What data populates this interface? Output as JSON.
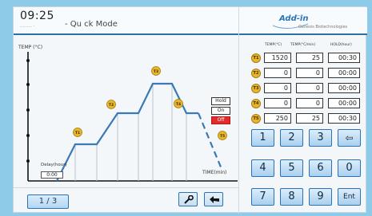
{
  "header": {
    "time": "09:25",
    "time_sub": "……… ·",
    "mode_title": "- Qu ck Mode",
    "brand": "Add-in",
    "brand_tagline": "Genesis Biotechnologies"
  },
  "chart": {
    "y_axis_label": "TEMP (°C)",
    "x_axis_label": "TIME(min)",
    "step_labels": [
      "T1",
      "T2",
      "T3",
      "T4",
      "T5"
    ],
    "legend": {
      "hold": "Hold",
      "on": "On",
      "off": "Off"
    },
    "delay_label": "Delay(hour)",
    "delay_value": "0:00"
  },
  "table": {
    "col_temp": "TEMP(°C)",
    "col_tempmin": "TEMP(°C/min)",
    "col_hold": "HOLD(hour)",
    "rows": [
      {
        "step": "T1",
        "temp": "1520",
        "rate": "25",
        "hold": "00:30"
      },
      {
        "step": "T2",
        "temp": "0",
        "rate": "0",
        "hold": "00:00"
      },
      {
        "step": "T3",
        "temp": "0",
        "rate": "0",
        "hold": "00:00"
      },
      {
        "step": "T4",
        "temp": "0",
        "rate": "0",
        "hold": "00:00"
      },
      {
        "step": "T5",
        "temp": "250",
        "rate": "25",
        "hold": "00:30"
      }
    ]
  },
  "keypad": {
    "k1": "1",
    "k2": "2",
    "k3": "3",
    "kback": "⇦",
    "k4": "4",
    "k5": "5",
    "k6": "6",
    "k0": "0",
    "k7": "7",
    "k8": "8",
    "k9": "9",
    "kent": "Ent"
  },
  "footer": {
    "page_indicator": "1 / 3",
    "settings_icon": "wrench-icon",
    "back_icon": "return-arrow-icon"
  }
}
